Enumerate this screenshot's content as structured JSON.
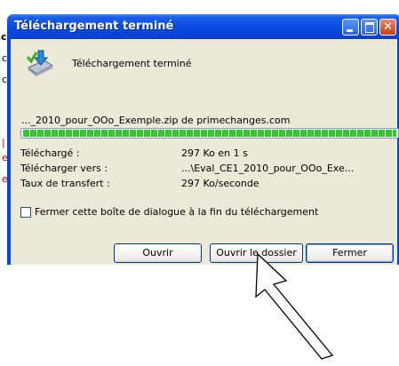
{
  "background": {
    "chars": [
      "c",
      "c",
      "c",
      "|",
      "e",
      "e"
    ]
  },
  "dialog": {
    "title": "Téléchargement terminé",
    "heading": "Téléchargement terminé",
    "file_source": "..._2010_pour_OOo_Exemple.zip de primechanges.com",
    "progress_percent": 100,
    "rows": [
      {
        "label": "Téléchargé :",
        "value": "297 Ko en 1 s"
      },
      {
        "label": "Télécharger vers :",
        "value": "...\\Eval_CE1_2010_pour_OOo_Exe..."
      },
      {
        "label": "Taux de transfert :",
        "value": "297 Ko/seconde"
      }
    ],
    "close_checkbox_label": "Fermer cette boîte de dialogue à la fin du téléchargement",
    "close_checkbox_checked": false,
    "buttons": {
      "open": "Ouvrir",
      "open_folder": "Ouvrir le dossier",
      "close": "Fermer"
    }
  },
  "colors": {
    "titlebar": "#0a4ee2",
    "client": "#ece9d8",
    "progress": "#37c72c",
    "close_button": "#c6401f"
  }
}
